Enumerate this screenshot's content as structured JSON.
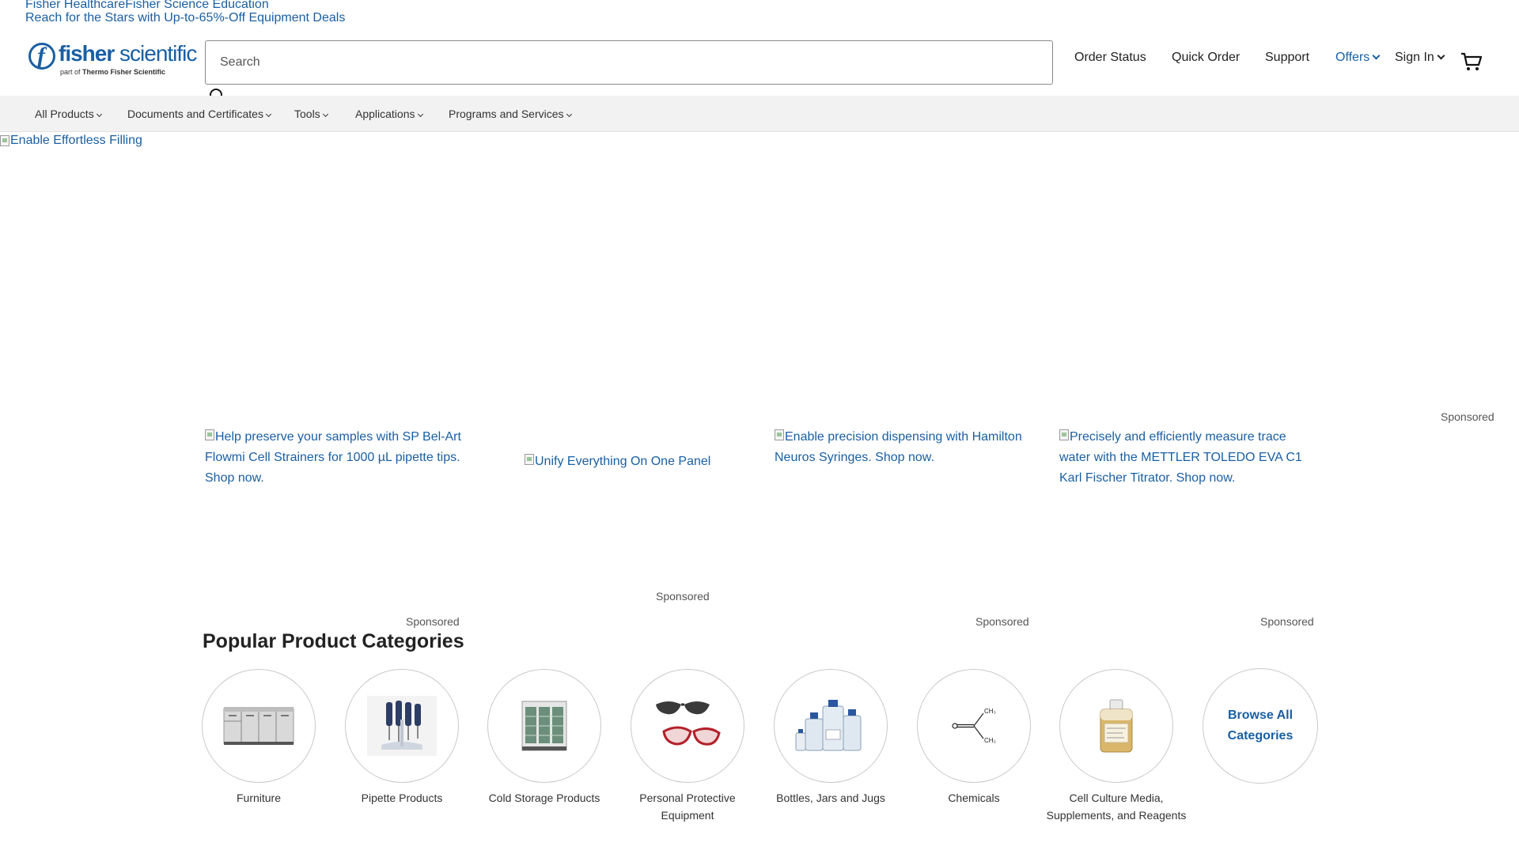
{
  "top_links": {
    "healthcare": "Fisher Healthcare",
    "education": "Fisher Science Education",
    "promo": "Reach for the Stars with Up-to-65%-Off Equipment Deals"
  },
  "logo": {
    "word_bold": "fisher",
    "word_light": " scientific",
    "sub_prefix": "part of ",
    "sub_brand": "Thermo Fisher Scientific"
  },
  "search": {
    "placeholder": "Search"
  },
  "utility": {
    "order_status": "Order Status",
    "quick_order": "Quick Order",
    "support": "Support",
    "offers": "Offers",
    "sign_in": "Sign In"
  },
  "nav": {
    "items": [
      {
        "label": "All Products"
      },
      {
        "label": "Documents and Certificates"
      },
      {
        "label": "Tools"
      },
      {
        "label": "Applications"
      },
      {
        "label": "Programs and Services"
      }
    ]
  },
  "hero": {
    "alt": "Enable Effortless Filling"
  },
  "sponsored_label": "Sponsored",
  "promos": [
    {
      "alt": "Help preserve your samples with SP Bel-Art Flowmi Cell Strainers for 1000 µL pipette tips. Shop now."
    },
    {
      "alt": "Unify Everything On One Panel"
    },
    {
      "alt": "Enable precision dispensing with Hamilton Neuros Syringes. Shop now."
    },
    {
      "alt": "Precisely and efficiently measure trace water with the METTLER TOLEDO EVA C1 Karl Fischer Titrator. Shop now."
    }
  ],
  "categories": {
    "title": "Popular Product Categories",
    "items": [
      {
        "label": "Furniture",
        "icon": "cabinet-icon"
      },
      {
        "label": "Pipette Products",
        "icon": "pipette-icon"
      },
      {
        "label": "Cold Storage Products",
        "icon": "refrigerator-icon"
      },
      {
        "label": "Personal Protective Equipment",
        "icon": "safety-glasses-icon"
      },
      {
        "label": "Bottles, Jars and Jugs",
        "icon": "bottles-icon"
      },
      {
        "label": "Chemicals",
        "icon": "chemical-structure-icon"
      },
      {
        "label": "Cell Culture Media, Supplements, and Reagents",
        "icon": "media-bottle-icon"
      }
    ],
    "browse_all": "Browse All Categories"
  },
  "colors": {
    "brand": "#1a5fa3",
    "nav_bg": "#f2f2f2"
  }
}
